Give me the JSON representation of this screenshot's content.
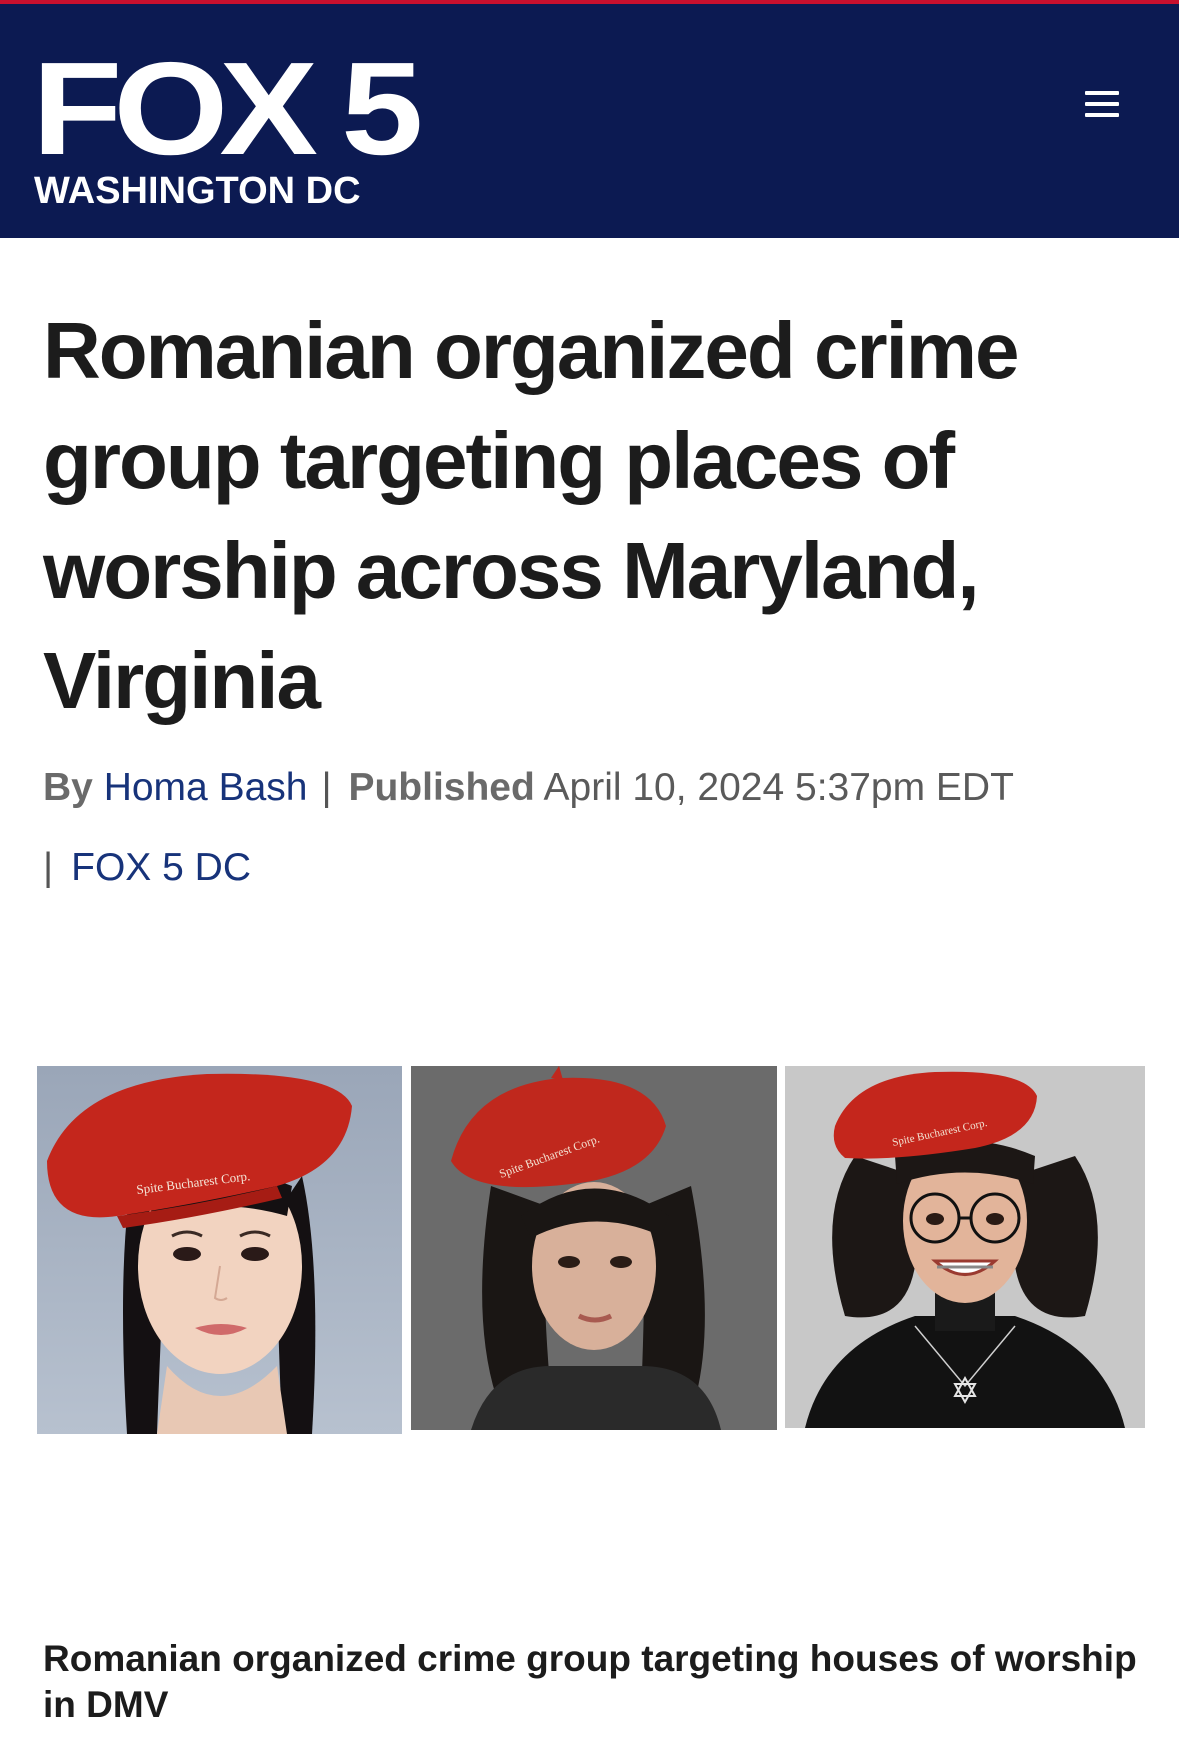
{
  "header": {
    "logo_main": "FOX 5",
    "logo_sub": "WASHINGTON DC",
    "menu_icon": "hamburger-menu-icon",
    "background_color": "#0c1a52"
  },
  "article": {
    "headline": "Romanian organized crime group targeting places of worship across Maryland, Virginia",
    "byline_prefix": "By",
    "author": "Homa Bash",
    "published_label": "Published",
    "published_date": "April 10, 2024 5:37pm EDT",
    "source": "FOX 5 DC"
  },
  "images": [
    {
      "beret_text": "Spite Bucharest Corp."
    },
    {
      "beret_text": "Spite Bucharest Corp."
    },
    {
      "beret_text": "Spite Bucharest Corp."
    }
  ],
  "video": {
    "title": "Romanian organized crime group targeting houses of worship in DMV"
  }
}
